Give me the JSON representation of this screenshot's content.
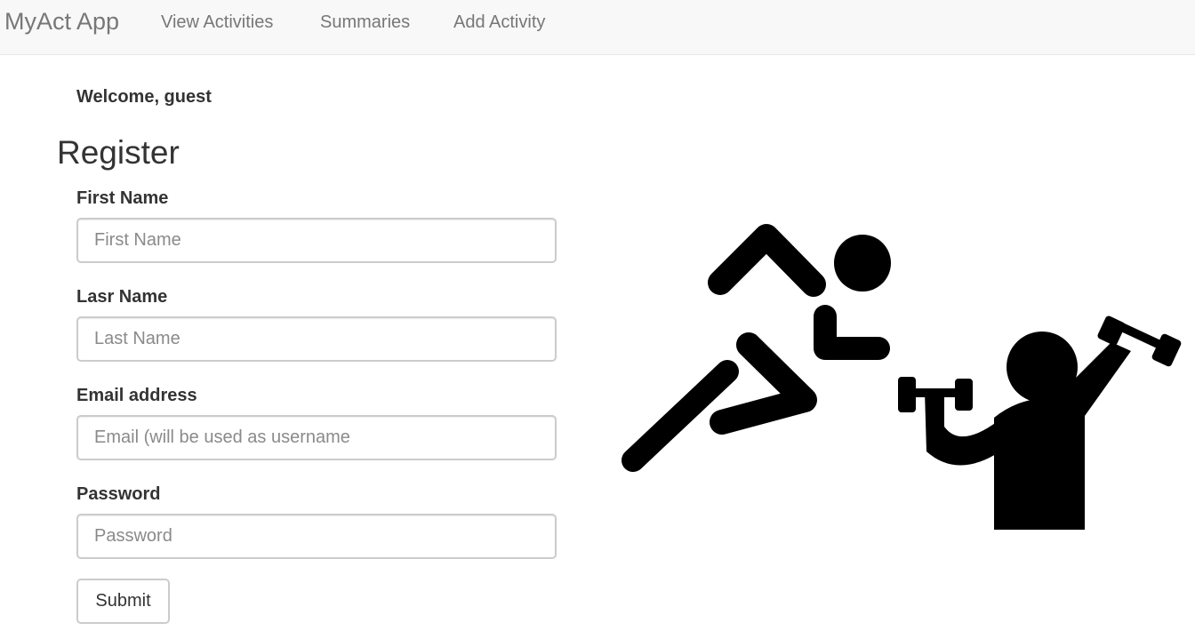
{
  "app": {
    "brand": "MyAct App"
  },
  "nav": {
    "items": [
      {
        "label": "View Activities"
      },
      {
        "label": "Summaries"
      },
      {
        "label": "Add Activity"
      }
    ]
  },
  "welcome": "Welcome, guest",
  "page_title": "Register",
  "form": {
    "fields": [
      {
        "label": "First Name",
        "placeholder": "First Name",
        "value": ""
      },
      {
        "label": "Lasr Name",
        "placeholder": "Last Name",
        "value": ""
      },
      {
        "label": "Email address",
        "placeholder": "Email (will be used as username",
        "value": ""
      },
      {
        "label": "Password",
        "placeholder": "Password",
        "value": ""
      }
    ],
    "submit_label": "Submit"
  },
  "illustration": {
    "icons": [
      "runner-icon",
      "weightlifter-icon"
    ],
    "color": "#000000"
  },
  "colors": {
    "navbar_bg": "#f8f8f8",
    "nav_text": "#777777",
    "input_border": "#cccccc"
  }
}
